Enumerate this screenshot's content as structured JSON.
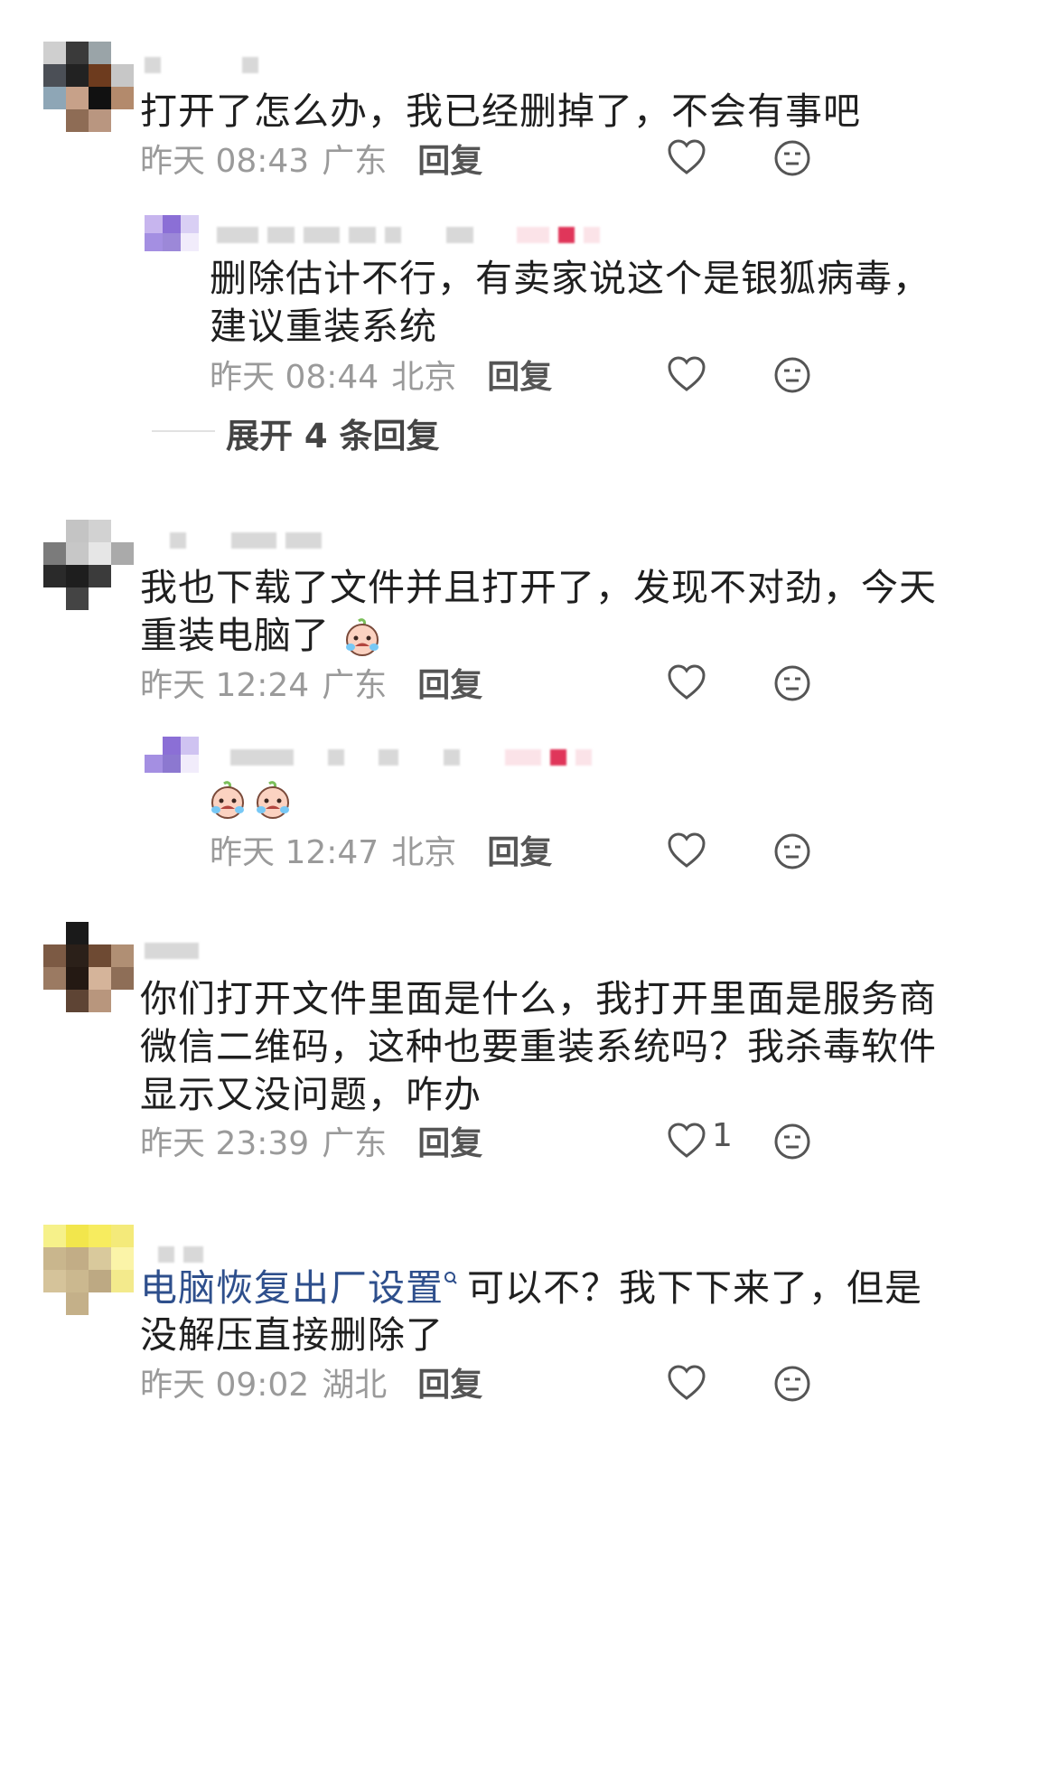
{
  "comments": [
    {
      "text": "打开了怎么办，我已经删掉了，不会有事吧",
      "time": "昨天 08:43",
      "location": "广东",
      "reply_label": "回复",
      "likes": "",
      "replies": [
        {
          "text_line1": "删除估计不行，有卖家说这个是银狐病毒，",
          "text_line2": "建议重装系统",
          "time": "昨天 08:44",
          "location": "北京",
          "reply_label": "回复"
        }
      ],
      "expand_label": "展开 4 条回复"
    },
    {
      "text_line1": "我也下载了文件并且打开了，发现不对劲，今天",
      "text_line2": "重装电脑了",
      "time": "昨天 12:24",
      "location": "广东",
      "reply_label": "回复",
      "likes": "",
      "replies": [
        {
          "time": "昨天 12:47",
          "location": "北京",
          "reply_label": "回复"
        }
      ]
    },
    {
      "text_line1": "你们打开文件里面是什么，我打开里面是服务商",
      "text_line2": "微信二维码，这种也要重装系统吗？我杀毒软件",
      "text_line3": "显示又没问题，咋办",
      "time": "昨天 23:39",
      "location": "广东",
      "reply_label": "回复",
      "likes": "1"
    },
    {
      "link_text": "电脑恢复出厂设置",
      "text_line1_rest": "可以不？我下下来了，但是",
      "text_line2": "没解压直接删除了",
      "time": "昨天 09:02",
      "location": "湖北",
      "reply_label": "回复",
      "likes": ""
    }
  ],
  "icons": {
    "like": "heart-outline-icon",
    "dislike": "neutral-face-icon",
    "emoji": "crying-face-emoji",
    "search_hint": "search-icon"
  },
  "colors": {
    "meta_gray": "#9a9a9a",
    "link_blue": "#2e4f8c",
    "red_badge": "#e0365a"
  }
}
